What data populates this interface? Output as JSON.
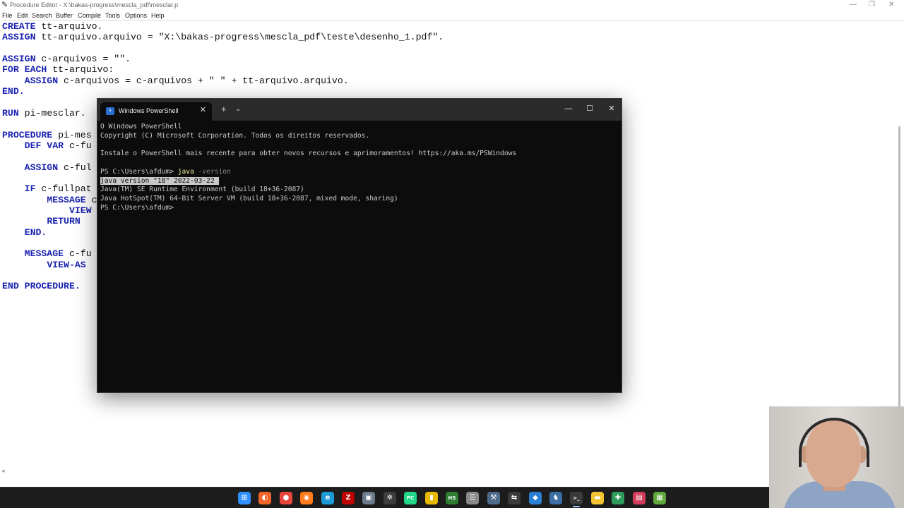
{
  "editor": {
    "title": "Procedure Editor - X:\\bakas-progress\\mescla_pdf\\mesclar.p",
    "menu": [
      "File",
      "Edit",
      "Search",
      "Buffer",
      "Compile",
      "Tools",
      "Options",
      "Help"
    ],
    "lines": [
      [
        {
          "t": "CREATE",
          "k": true
        },
        {
          "t": " tt-arquivo."
        }
      ],
      [
        {
          "t": "ASSIGN",
          "k": true
        },
        {
          "t": " tt-arquivo.arquivo = \"X:\\bakas-progress\\mescla_pdf\\teste\\desenho_1.pdf\"."
        }
      ],
      [],
      [
        {
          "t": "ASSIGN",
          "k": true
        },
        {
          "t": " c-arquivos = \"\"."
        }
      ],
      [
        {
          "t": "FOR EACH",
          "k": true
        },
        {
          "t": " tt-arquivo:"
        }
      ],
      [
        {
          "t": "    "
        },
        {
          "t": "ASSIGN",
          "k": true
        },
        {
          "t": " c-arquivos = c-arquivos + \" \" + tt-arquivo.arquivo."
        }
      ],
      [
        {
          "t": "END.",
          "k": true
        }
      ],
      [],
      [
        {
          "t": "RUN",
          "k": true
        },
        {
          "t": " pi-mesclar."
        }
      ],
      [],
      [
        {
          "t": "PROCEDURE",
          "k": true
        },
        {
          "t": " pi-mes"
        }
      ],
      [
        {
          "t": "    "
        },
        {
          "t": "DEF VAR",
          "k": true
        },
        {
          "t": " c-fu"
        }
      ],
      [],
      [
        {
          "t": "    "
        },
        {
          "t": "ASSIGN",
          "k": true
        },
        {
          "t": " c-ful"
        }
      ],
      [],
      [
        {
          "t": "    "
        },
        {
          "t": "IF",
          "k": true
        },
        {
          "t": " c-fullpat"
        }
      ],
      [
        {
          "t": "        "
        },
        {
          "t": "MESSAGE",
          "k": true
        },
        {
          "t": " c"
        }
      ],
      [
        {
          "t": "            "
        },
        {
          "t": "VIEW",
          "k": true
        }
      ],
      [
        {
          "t": "        "
        },
        {
          "t": "RETURN",
          "k": true
        },
        {
          "t": " "
        }
      ],
      [
        {
          "t": "    "
        },
        {
          "t": "END.",
          "k": true
        }
      ],
      [],
      [
        {
          "t": "    "
        },
        {
          "t": "MESSAGE",
          "k": true
        },
        {
          "t": " c-fu"
        }
      ],
      [
        {
          "t": "        "
        },
        {
          "t": "VIEW-AS",
          "k": true
        }
      ],
      [],
      [
        {
          "t": "END PROCEDURE.",
          "k": true
        }
      ]
    ]
  },
  "terminal": {
    "tab_title": "Windows PowerShell",
    "tab_close": "✕",
    "new_tab": "+",
    "dropdown": "⌄",
    "minimize": "—",
    "maximize": "☐",
    "close": "✕",
    "lines": [
      {
        "text": "O Windows PowerShell"
      },
      {
        "text": "Copyright (C) Microsoft Corporation. Todos os direitos reservados."
      },
      {
        "text": ""
      },
      {
        "text": "Instale o PowerShell mais recente para obter novos recursos e aprimoramentos! https://aka.ms/PSWindows"
      },
      {
        "text": ""
      },
      {
        "prompt": "PS C:\\Users\\afdum> ",
        "cmd": "java",
        "param": " -version"
      },
      {
        "text": "java version \"18\" 2022-03-22 ",
        "selected": true
      },
      {
        "text": "Java(TM) SE Runtime Environment (build 18+36-2087)"
      },
      {
        "text": "Java HotSpot(TM) 64-Bit Server VM (build 18+36-2087, mixed mode, sharing)"
      },
      {
        "text": "PS C:\\Users\\afdum>"
      }
    ]
  },
  "taskbar": {
    "items": [
      {
        "name": "start",
        "glyph": "⊞",
        "color": "#2f8fff"
      },
      {
        "name": "app-orange",
        "glyph": "◐",
        "color": "#f0652a"
      },
      {
        "name": "chrome",
        "glyph": "●",
        "color": "#e8453c"
      },
      {
        "name": "firefox",
        "glyph": "◉",
        "color": "#ff7b1c"
      },
      {
        "name": "edge",
        "glyph": "e",
        "color": "#1d9bd8"
      },
      {
        "name": "filezilla",
        "glyph": "Z",
        "color": "#bf0000"
      },
      {
        "name": "app-window",
        "glyph": "▣",
        "color": "#6a7a8a"
      },
      {
        "name": "app-wheel",
        "glyph": "✲",
        "color": "#3d3d3d"
      },
      {
        "name": "pycharm",
        "glyph": "PC",
        "color": "#21d789"
      },
      {
        "name": "app-yellow",
        "glyph": "▮",
        "color": "#e6b800"
      },
      {
        "name": "app-hs",
        "glyph": "HS",
        "color": "#2e7d32"
      },
      {
        "name": "database",
        "glyph": "☰",
        "color": "#8a8a8a"
      },
      {
        "name": "app-tool",
        "glyph": "⚒",
        "color": "#4d6b8a"
      },
      {
        "name": "app-arrows",
        "glyph": "⇆",
        "color": "#3a3a3a"
      },
      {
        "name": "vscode",
        "glyph": "◆",
        "color": "#2a7fd4"
      },
      {
        "name": "postgres",
        "glyph": "♞",
        "color": "#3b6ea5"
      },
      {
        "name": "terminal",
        "glyph": ">_",
        "color": "#3a3a3a"
      },
      {
        "name": "file-explorer",
        "glyph": "▬",
        "color": "#f4c430"
      },
      {
        "name": "app-green",
        "glyph": "✚",
        "color": "#2e9c5a"
      },
      {
        "name": "app-photo",
        "glyph": "▤",
        "color": "#d23c5a"
      },
      {
        "name": "app-doc",
        "glyph": "▦",
        "color": "#5fa83a"
      }
    ]
  }
}
